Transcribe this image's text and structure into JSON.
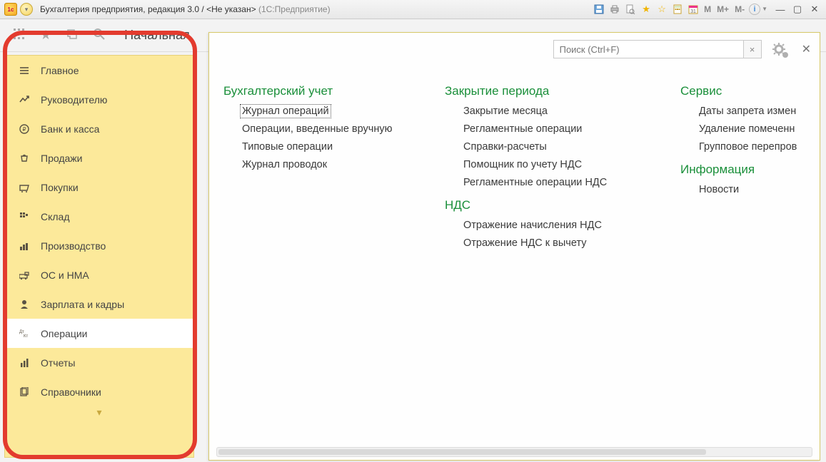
{
  "window": {
    "title_main": "Бухгалтерия предприятия, редакция 3.0 / <Не указан>",
    "title_suffix": "(1С:Предприятие)"
  },
  "toolbar_memory": {
    "m": "M",
    "mplus": "M+",
    "mminus": "M-"
  },
  "page_title": "Начальная",
  "search": {
    "placeholder": "Поиск (Ctrl+F)"
  },
  "sidebar": {
    "items": [
      {
        "label": "Главное",
        "active": false
      },
      {
        "label": "Руководителю",
        "active": false
      },
      {
        "label": "Банк и касса",
        "active": false
      },
      {
        "label": "Продажи",
        "active": false
      },
      {
        "label": "Покупки",
        "active": false
      },
      {
        "label": "Склад",
        "active": false
      },
      {
        "label": "Производство",
        "active": false
      },
      {
        "label": "ОС и НМА",
        "active": false
      },
      {
        "label": "Зарплата и кадры",
        "active": false
      },
      {
        "label": "Операции",
        "active": true
      },
      {
        "label": "Отчеты",
        "active": false
      },
      {
        "label": "Справочники",
        "active": false
      }
    ]
  },
  "flyout": {
    "columns": [
      {
        "sections": [
          {
            "title": "Бухгалтерский учет",
            "links": [
              {
                "label": "Журнал операций",
                "focused": true
              },
              {
                "label": "Операции, введенные вручную"
              },
              {
                "label": "Типовые операции"
              },
              {
                "label": "Журнал проводок"
              }
            ]
          }
        ]
      },
      {
        "sections": [
          {
            "title": "Закрытие периода",
            "links": [
              {
                "label": "Закрытие месяца"
              },
              {
                "label": "Регламентные операции"
              },
              {
                "label": "Справки-расчеты"
              },
              {
                "label": "Помощник по учету НДС"
              },
              {
                "label": "Регламентные операции НДС"
              }
            ]
          },
          {
            "title": "НДС",
            "links": [
              {
                "label": "Отражение начисления НДС"
              },
              {
                "label": "Отражение НДС к вычету"
              }
            ]
          }
        ]
      },
      {
        "sections": [
          {
            "title": "Сервис",
            "links": [
              {
                "label": "Даты запрета измен"
              },
              {
                "label": "Удаление помеченн"
              },
              {
                "label": "Групповое перепров"
              }
            ]
          },
          {
            "title": "Информация",
            "links": [
              {
                "label": "Новости"
              }
            ]
          }
        ]
      }
    ]
  }
}
